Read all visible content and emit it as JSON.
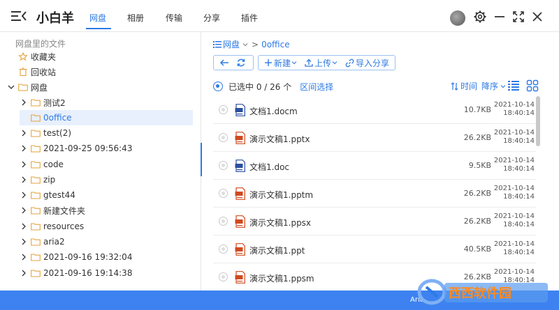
{
  "app": {
    "title": "小白羊"
  },
  "tabs": [
    {
      "label": "网盘",
      "active": true
    },
    {
      "label": "相册"
    },
    {
      "label": "传输"
    },
    {
      "label": "分享"
    },
    {
      "label": "插件"
    }
  ],
  "tree": {
    "section_label": "网盘里的文件",
    "items": [
      {
        "label": "收藏夹",
        "icon": "star-folder-icon"
      },
      {
        "label": "回收站",
        "icon": "trash-icon"
      },
      {
        "label": "网盘",
        "icon": "folder-icon",
        "expanded": true
      },
      {
        "label": "测试2"
      },
      {
        "label": "0office",
        "selected": true
      },
      {
        "label": "test(2)"
      },
      {
        "label": "2021-09-25 09:56:43"
      },
      {
        "label": "code"
      },
      {
        "label": "zip"
      },
      {
        "label": "gtest44"
      },
      {
        "label": "新建文件夹"
      },
      {
        "label": "resources"
      },
      {
        "label": "aria2"
      },
      {
        "label": "2021-09-16 19:32:04"
      },
      {
        "label": "2021-09-16 19:14:38"
      }
    ]
  },
  "breadcrumb": {
    "root": "网盘",
    "current": "0office"
  },
  "toolbar": {
    "new_label": "新建",
    "upload_label": "上传",
    "import_label": "导入分享"
  },
  "selection": {
    "text": "已选中 0 / 26 个",
    "range_label": "区间选择"
  },
  "sort": {
    "field_label": "时间",
    "order_label": "降序"
  },
  "files": [
    {
      "name": "文档1.docm",
      "size": "10.7KB",
      "date": "2021-10-14",
      "time": "18:40:14",
      "type": "doc"
    },
    {
      "name": "演示文稿1.pptx",
      "size": "26.2KB",
      "date": "2021-10-14",
      "time": "18:40:14",
      "type": "ppt"
    },
    {
      "name": "文档1.doc",
      "size": "9.5KB",
      "date": "2021-10-14",
      "time": "18:40:14",
      "type": "doc"
    },
    {
      "name": "演示文稿1.pptm",
      "size": "26.2KB",
      "date": "2021-10-14",
      "time": "18:40:14",
      "type": "ppt"
    },
    {
      "name": "演示文稿1.ppsx",
      "size": "26.2KB",
      "date": "2021-10-14",
      "time": "18:40:14",
      "type": "ppt"
    },
    {
      "name": "演示文稿1.ppt",
      "size": "40.5KB",
      "date": "2021-10-14",
      "time": "18:40:14",
      "type": "ppt"
    },
    {
      "name": "演示文稿1.ppsm",
      "size": "26.2KB",
      "date": "2021-10-14",
      "time": "18:40:14",
      "type": "ppt"
    }
  ],
  "status": {
    "text": "Aria"
  },
  "watermark": {
    "text": "西西软件园"
  },
  "colors": {
    "accent": "#2d7ae5",
    "status_bar": "#3d82f0",
    "folder": "#e6a23c",
    "doc": "#2b4ea0",
    "ppt": "#d04a1f"
  }
}
